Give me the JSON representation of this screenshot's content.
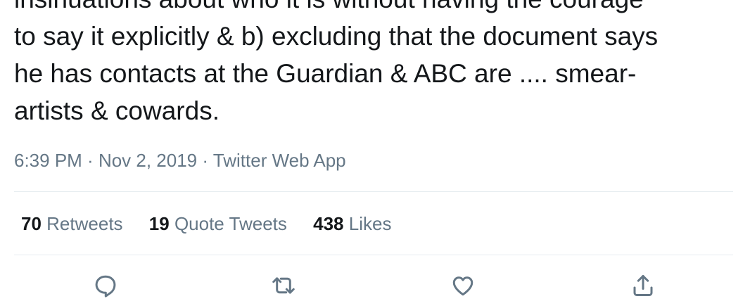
{
  "tweet": {
    "text": "insinuations about who it is without having the courage\nto say it explicitly & b) excluding that the document says\nhe has contacts at the Guardian & ABC are .... smear-\nartists & cowards.",
    "time": "6:39 PM",
    "separator": " · ",
    "date": "Nov 2, 2019",
    "source": "Twitter Web App"
  },
  "stats": {
    "retweets": {
      "count": "70",
      "label": "Retweets"
    },
    "quote_tweets": {
      "count": "19",
      "label": "Quote Tweets"
    },
    "likes": {
      "count": "438",
      "label": "Likes"
    }
  },
  "actions": {
    "icons": [
      "reply-icon",
      "retweet-icon",
      "like-icon",
      "share-icon"
    ]
  },
  "colors": {
    "text": "#14171a",
    "secondary": "#657786",
    "divider": "#e6ecf0"
  }
}
